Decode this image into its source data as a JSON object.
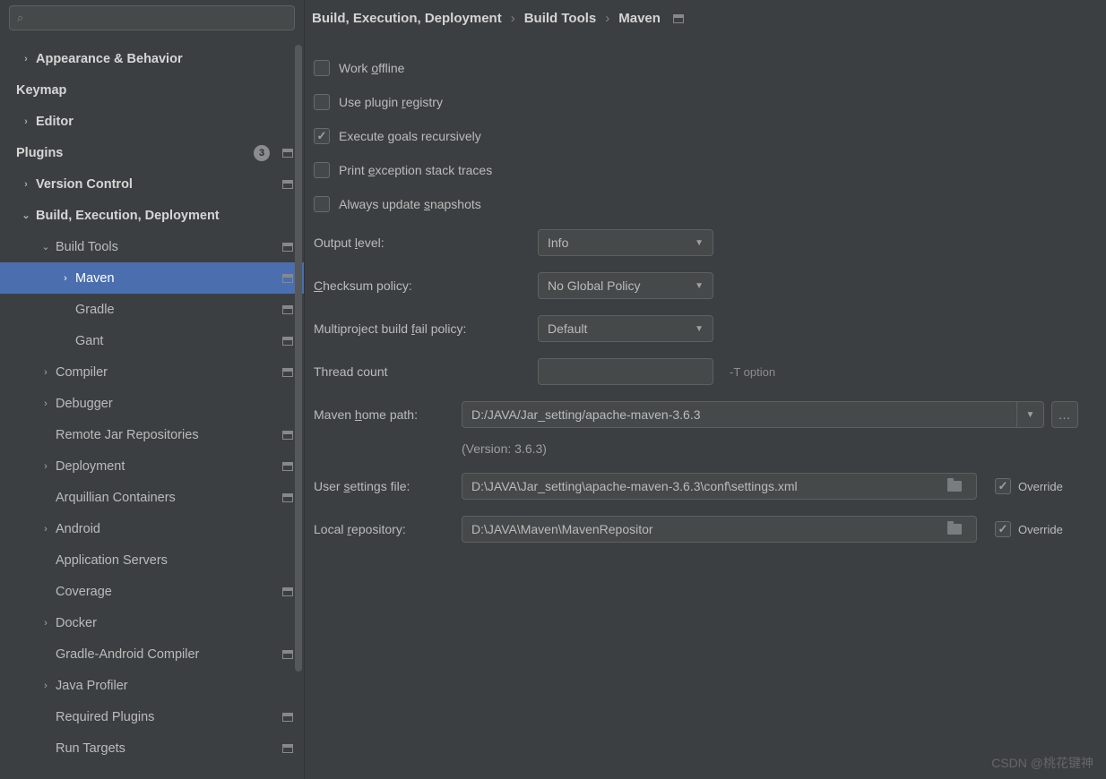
{
  "search": {
    "placeholder": ""
  },
  "tree": {
    "items": [
      {
        "label": "Appearance & Behavior",
        "arrow": "›",
        "bold": true,
        "lvl": 0
      },
      {
        "label": "Keymap",
        "arrow": "",
        "bold": true,
        "lvl": 0,
        "noArrow": true
      },
      {
        "label": "Editor",
        "arrow": "›",
        "bold": true,
        "lvl": 0
      },
      {
        "label": "Plugins",
        "arrow": "",
        "bold": true,
        "lvl": 0,
        "noArrow": true,
        "badge": "3",
        "proj": true
      },
      {
        "label": "Version Control",
        "arrow": "›",
        "bold": true,
        "lvl": 0,
        "proj": true
      },
      {
        "label": "Build, Execution, Deployment",
        "arrow": "⌄",
        "bold": true,
        "lvl": 0
      },
      {
        "label": "Build Tools",
        "arrow": "⌄",
        "lvl": 1,
        "proj": true
      },
      {
        "label": "Maven",
        "arrow": "›",
        "lvl": 2,
        "selected": true,
        "proj": true
      },
      {
        "label": "Gradle",
        "arrow": "",
        "lvl": 2,
        "noArrowOnly": true,
        "proj": true
      },
      {
        "label": "Gant",
        "arrow": "",
        "lvl": 2,
        "noArrowOnly": true,
        "proj": true
      },
      {
        "label": "Compiler",
        "arrow": "›",
        "lvl": 1,
        "proj": true
      },
      {
        "label": "Debugger",
        "arrow": "›",
        "lvl": 1
      },
      {
        "label": "Remote Jar Repositories",
        "arrow": "",
        "lvl": 1,
        "noArrow": true,
        "proj": true
      },
      {
        "label": "Deployment",
        "arrow": "›",
        "lvl": 1,
        "proj": true
      },
      {
        "label": "Arquillian Containers",
        "arrow": "",
        "lvl": 1,
        "noArrow": true,
        "proj": true
      },
      {
        "label": "Android",
        "arrow": "›",
        "lvl": 1
      },
      {
        "label": "Application Servers",
        "arrow": "",
        "lvl": 1,
        "noArrow": true
      },
      {
        "label": "Coverage",
        "arrow": "",
        "lvl": 1,
        "noArrow": true,
        "proj": true
      },
      {
        "label": "Docker",
        "arrow": "›",
        "lvl": 1
      },
      {
        "label": "Gradle-Android Compiler",
        "arrow": "",
        "lvl": 1,
        "noArrow": true,
        "proj": true
      },
      {
        "label": "Java Profiler",
        "arrow": "›",
        "lvl": 1
      },
      {
        "label": "Required Plugins",
        "arrow": "",
        "lvl": 1,
        "noArrow": true,
        "proj": true
      },
      {
        "label": "Run Targets",
        "arrow": "",
        "lvl": 1,
        "noArrow": true,
        "proj": true
      }
    ]
  },
  "breadcrumb": {
    "a": "Build, Execution, Deployment",
    "b": "Build Tools",
    "c": "Maven"
  },
  "checkboxes": {
    "offline_pre": "Work ",
    "offline_u": "o",
    "offline_post": "ffline",
    "registry_pre": "Use plugin ",
    "registry_u": "r",
    "registry_post": "egistry",
    "recursive_pre": "Execute ",
    "recursive_u": "g",
    "recursive_post": "oals recursively",
    "stack_pre": "Print ",
    "stack_u": "e",
    "stack_post": "xception stack traces",
    "snap_pre": "Always update ",
    "snap_u": "s",
    "snap_post": "napshots"
  },
  "fields": {
    "output_label_pre": "Output ",
    "output_label_u": "l",
    "output_label_post": "evel:",
    "output_value": "Info",
    "checksum_label_u": "C",
    "checksum_label_post": "hecksum policy:",
    "checksum_value": "No Global Policy",
    "fail_label_pre": "Multiproject build ",
    "fail_label_u": "f",
    "fail_label_post": "ail policy:",
    "fail_value": "Default",
    "threads_label": "Thread count",
    "threads_value": "",
    "threads_hint": "-T option",
    "home_label_pre": "Maven ",
    "home_label_u": "h",
    "home_label_post": "ome path:",
    "home_value": "D:/JAVA/Jar_setting/apache-maven-3.6.3",
    "version": "(Version: 3.6.3)",
    "settings_label_pre": "User ",
    "settings_label_u": "s",
    "settings_label_post": "ettings file:",
    "settings_value": "D:\\JAVA\\Jar_setting\\apache-maven-3.6.3\\conf\\settings.xml",
    "repo_label_pre": "Local ",
    "repo_label_u": "r",
    "repo_label_post": "epository:",
    "repo_value": "D:\\JAVA\\Maven\\MavenRepositor",
    "override": "Override"
  },
  "watermark": "CSDN @桃花键神"
}
